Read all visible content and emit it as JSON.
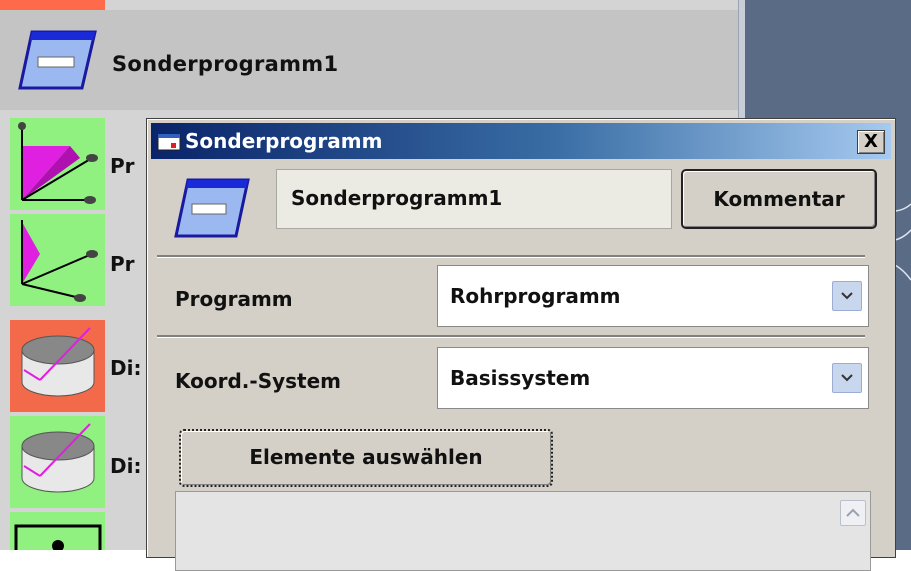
{
  "list": {
    "selected_item": {
      "label": "Sonderprogramm1"
    },
    "items": [
      {
        "label": "Pr"
      },
      {
        "label": "Pr"
      },
      {
        "label": "Di:"
      },
      {
        "label": "Di:"
      }
    ]
  },
  "dialog": {
    "title": "Sonderprogramm",
    "close_label": "X",
    "name_value": "Sonderprogramm1",
    "comment_button": "Kommentar",
    "programm_label": "Programm",
    "programm_value": "Rohrprogramm",
    "koord_label": "Koord.-System",
    "koord_value": "Basissystem",
    "select_elements_button": "Elemente auswählen"
  },
  "colors": {
    "title_bar_start": "#0a246a",
    "title_bar_end": "#a6caf0",
    "thumb_green": "#90f080",
    "thumb_red": "#f26a4a",
    "magenta": "#e020e0"
  }
}
